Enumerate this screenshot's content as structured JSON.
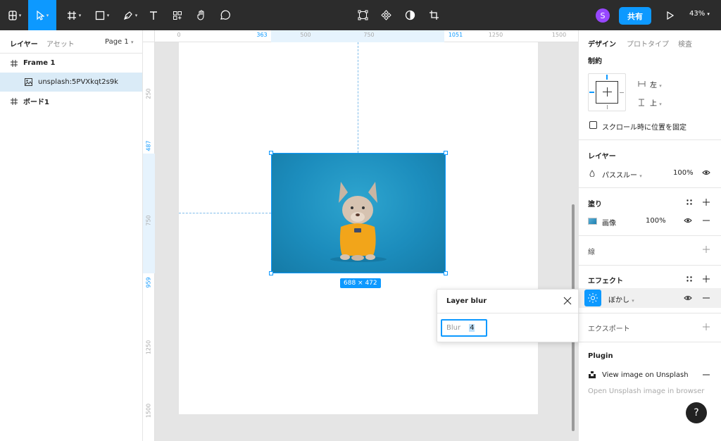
{
  "toolbar": {
    "share_label": "共有",
    "avatar_initial": "S",
    "zoom_label": "43%"
  },
  "left_panel": {
    "tabs": {
      "layers": "レイヤー",
      "assets": "アセット"
    },
    "page_select": "Page 1",
    "layers": [
      {
        "name": "Frame 1",
        "icon": "frame-icon",
        "bold": true
      },
      {
        "name": "unsplash:5PVXkqt2s9k",
        "icon": "image-icon",
        "selected": true
      },
      {
        "name": "ボード1",
        "icon": "frame-icon",
        "bold": true
      }
    ]
  },
  "canvas": {
    "ruler_top": {
      "ticks": [
        "0",
        "363",
        "500",
        "750",
        "1051",
        "1250",
        "1500"
      ]
    },
    "ruler_left": {
      "ticks": [
        "250",
        "487",
        "750",
        "959",
        "1250",
        "1500"
      ]
    },
    "selection_size": "688 × 472"
  },
  "blur_popup": {
    "title": "Layer blur",
    "field_label": "Blur",
    "field_value": "4"
  },
  "right_panel": {
    "tabs": {
      "design": "デザイン",
      "prototype": "プロトタイプ",
      "inspect": "検査"
    },
    "constraints": {
      "title": "制約",
      "horizontal": "左",
      "vertical": "上",
      "fix_scroll_label": "スクロール時に位置を固定"
    },
    "layer": {
      "title": "レイヤー",
      "blend_mode": "パススルー",
      "opacity": "100%"
    },
    "fill": {
      "title": "塗り",
      "type": "画像",
      "opacity": "100%"
    },
    "stroke": {
      "title": "線"
    },
    "effects": {
      "title": "エフェクト",
      "effect_name": "ぼかし"
    },
    "export": {
      "title": "エクスポート"
    },
    "plugin": {
      "title": "Plugin",
      "item_label": "View image on Unsplash",
      "hint": "Open Unsplash image in browser"
    },
    "help_label": "?"
  },
  "colors": {
    "accent": "#0d99ff",
    "toolbar_bg": "#2c2c2c",
    "avatar_bg": "#9747ff",
    "selection_bg": "#daebf7"
  }
}
